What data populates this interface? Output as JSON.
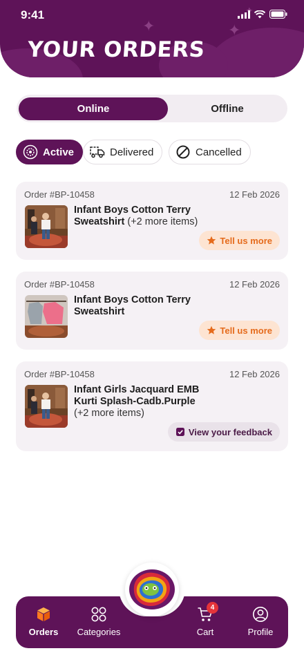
{
  "status_bar": {
    "time": "9:41"
  },
  "header": {
    "title": "YOUR ORDERS"
  },
  "toggle": {
    "online": "Online",
    "offline": "Offline",
    "selected": "Online"
  },
  "filters": [
    {
      "label": "Active",
      "icon": "active-gear-icon",
      "selected": true
    },
    {
      "label": "Delivered",
      "icon": "delivery-truck-icon",
      "selected": false
    },
    {
      "label": "Cancelled",
      "icon": "cancelled-circle-icon",
      "selected": false
    }
  ],
  "orders": [
    {
      "order_no": "Order #BP-10458",
      "date": "12 Feb 2026",
      "title": "Infant Boys Cotton Terry Sweatshirt",
      "more": "(+2 more items)",
      "action": "Tell us more",
      "action_icon": "star-icon"
    },
    {
      "order_no": "Order #BP-10458",
      "date": "12 Feb 2026",
      "title": "Infant Boys Cotton Terry Sweatshirt",
      "more": "",
      "action": "Tell us more",
      "action_icon": "star-icon"
    },
    {
      "order_no": "Order #BP-10458",
      "date": "12 Feb 2026",
      "title": "Infant Girls Jacquard EMB Kurti Splash-Cadb.Purple",
      "more": "(+2 more items)",
      "action": "View your feedback",
      "action_icon": "check-square-icon"
    }
  ],
  "bottom_nav": {
    "items": [
      {
        "label": "Orders",
        "icon": "box-icon",
        "active": true
      },
      {
        "label": "Categories",
        "icon": "grid-icon",
        "active": false
      },
      {
        "label": "Cart",
        "icon": "cart-icon",
        "active": false,
        "badge": "4"
      },
      {
        "label": "Profile",
        "icon": "profile-icon",
        "active": false
      }
    ],
    "center_logo": "Bachaa Party"
  },
  "colors": {
    "brand": "#5e1358",
    "accent_orange": "#e56b1c",
    "tell_bg": "#fde4d2",
    "badge": "#e5343a"
  }
}
